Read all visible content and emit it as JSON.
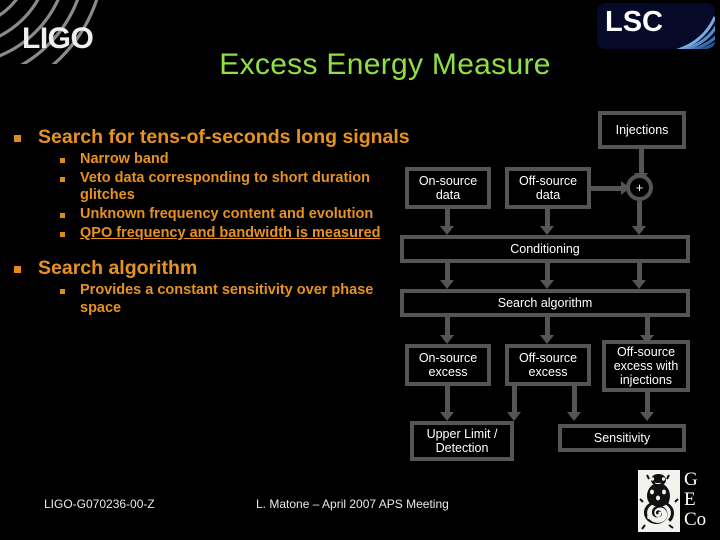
{
  "logos": {
    "ligo": {
      "name": "ligo-logo",
      "text": "LIGO"
    },
    "lsc": {
      "name": "lsc-logo",
      "text": "LSC"
    },
    "geco": {
      "name": "geco-logo",
      "l1": "G",
      "l2": "E",
      "l3": "Co"
    }
  },
  "title": "Excess Energy Measure",
  "colors": {
    "title_green": "#8ee046",
    "bullet_orange": "#e79220",
    "box_border": "#555555",
    "background": "#000000",
    "lsc_bg": "#060a28"
  },
  "bullets": [
    {
      "level1": "Search for tens-of-seconds long signals",
      "sub": [
        {
          "text": "Narrow band",
          "underline": false
        },
        {
          "text": "Veto data corresponding to short duration glitches",
          "underline": false
        },
        {
          "text": "Unknown frequency content and evolution",
          "underline": false
        },
        {
          "text": "QPO frequency and bandwidth is measured",
          "underline": true
        }
      ]
    },
    {
      "level1": "Search algorithm",
      "sub": [
        {
          "text": "Provides a constant sensitivity over phase space",
          "underline": false
        }
      ]
    }
  ],
  "flowchart": {
    "type": "flowchart",
    "nodes": [
      {
        "id": "injections",
        "label": "Injections"
      },
      {
        "id": "on-source-data",
        "label": "On-source data"
      },
      {
        "id": "off-source-data",
        "label": "Off-source data"
      },
      {
        "id": "adder",
        "label": "+"
      },
      {
        "id": "conditioning",
        "label": "Conditioning"
      },
      {
        "id": "search-algorithm",
        "label": "Search algorithm"
      },
      {
        "id": "on-source-excess",
        "label": "On-source excess"
      },
      {
        "id": "off-source-excess",
        "label": "Off-source excess"
      },
      {
        "id": "off-source-excess-injections",
        "label": "Off-source excess with injections"
      },
      {
        "id": "upper-limit",
        "label": "Upper Limit / Detection"
      },
      {
        "id": "sensitivity",
        "label": "Sensitivity"
      }
    ]
  },
  "footer": {
    "document_id": "LIGO-G070236-00-Z",
    "presenter": "L. Matone – April 2007 APS Meeting"
  }
}
